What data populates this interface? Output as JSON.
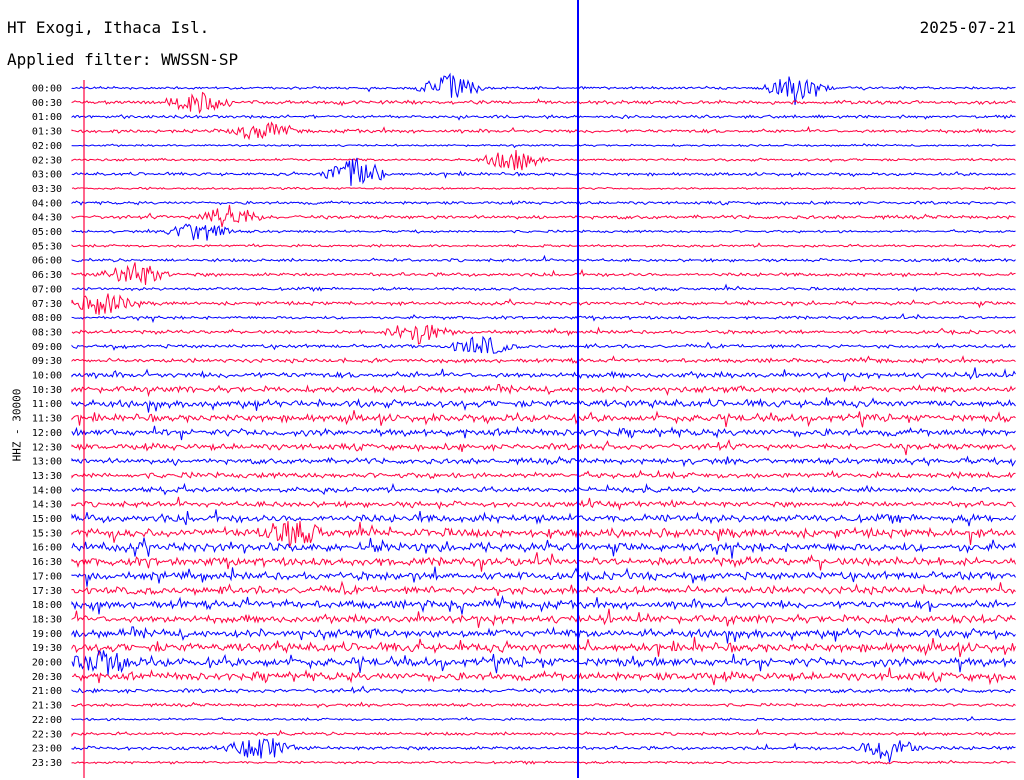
{
  "header": {
    "station": "HT Exogi, Ithaca Isl.",
    "date": "2025-07-21",
    "filter": "Applied filter: WWSSN-SP",
    "channel": "HHZ - 30000"
  },
  "colors": {
    "even_trace": "#0000ff",
    "odd_trace": "#ff0040",
    "marker": "#ff0040"
  },
  "chart_data": {
    "type": "line",
    "title": "HT Exogi, Ithaca Isl.",
    "subtitle": "Applied filter: WWSSN-SP",
    "ylabel": "HHZ - 30000",
    "xlabel": "",
    "categories": [
      "00:00",
      "00:30",
      "01:00",
      "01:30",
      "02:00",
      "02:30",
      "03:00",
      "03:30",
      "04:00",
      "04:30",
      "05:00",
      "05:30",
      "06:00",
      "06:30",
      "07:00",
      "07:30",
      "08:00",
      "08:30",
      "09:00",
      "09:30",
      "10:00",
      "10:30",
      "11:00",
      "11:30",
      "12:00",
      "12:30",
      "13:00",
      "13:30",
      "14:00",
      "14:30",
      "15:00",
      "15:30",
      "16:00",
      "16:30",
      "17:00",
      "17:30",
      "18:00",
      "18:30",
      "19:00",
      "19:30",
      "20:00",
      "20:30",
      "21:00",
      "21:30",
      "22:00",
      "22:30",
      "23:00",
      "23:30"
    ],
    "trace_color_cycle": [
      "blue",
      "red"
    ],
    "activity": [
      0.25,
      0.35,
      0.3,
      0.35,
      0.2,
      0.25,
      0.3,
      0.2,
      0.3,
      0.35,
      0.25,
      0.25,
      0.3,
      0.35,
      0.3,
      0.35,
      0.3,
      0.35,
      0.35,
      0.4,
      0.55,
      0.6,
      0.7,
      0.7,
      0.7,
      0.6,
      0.55,
      0.55,
      0.5,
      0.55,
      0.75,
      0.85,
      0.85,
      0.8,
      0.75,
      0.75,
      0.75,
      0.75,
      0.8,
      0.85,
      0.85,
      0.8,
      0.4,
      0.3,
      0.25,
      0.3,
      0.35,
      0.25
    ],
    "events": [
      {
        "row": 0,
        "minute": 12,
        "amp": 1.2
      },
      {
        "row": 0,
        "minute": 23,
        "amp": 1.4
      },
      {
        "row": 1,
        "minute": 4,
        "amp": 0.9
      },
      {
        "row": 3,
        "minute": 6,
        "amp": 0.8
      },
      {
        "row": 5,
        "minute": 14,
        "amp": 0.9
      },
      {
        "row": 6,
        "minute": 9,
        "amp": 1.5
      },
      {
        "row": 9,
        "minute": 5,
        "amp": 1.0
      },
      {
        "row": 10,
        "minute": 4,
        "amp": 1.0
      },
      {
        "row": 13,
        "minute": 2,
        "amp": 1.1
      },
      {
        "row": 15,
        "minute": 1,
        "amp": 1.0
      },
      {
        "row": 17,
        "minute": 11,
        "amp": 1.0
      },
      {
        "row": 18,
        "minute": 13,
        "amp": 0.9
      },
      {
        "row": 31,
        "minute": 7,
        "amp": 1.0
      },
      {
        "row": 40,
        "minute": 1,
        "amp": 0.9
      },
      {
        "row": 46,
        "minute": 6,
        "amp": 1.1
      },
      {
        "row": 46,
        "minute": 26,
        "amp": 1.2
      }
    ],
    "grid": false,
    "legend": "none"
  }
}
